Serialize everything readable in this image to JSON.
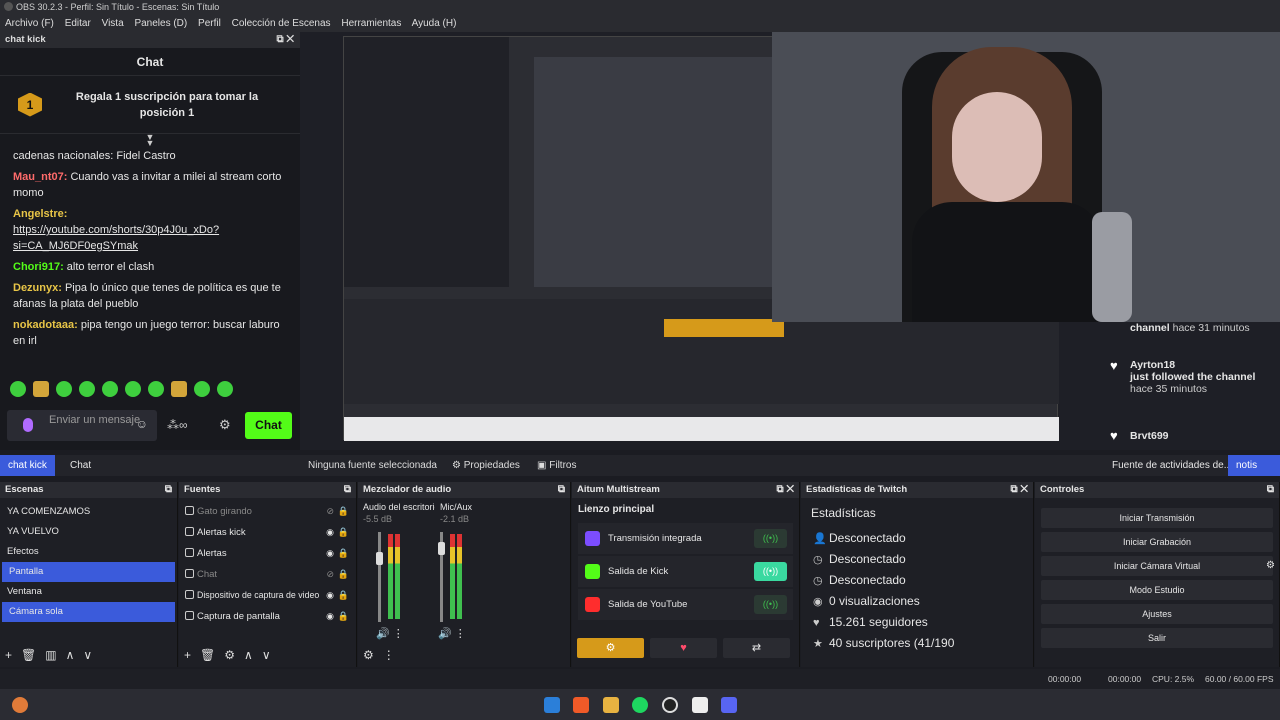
{
  "titlebar": {
    "title": "OBS 30.2.3 - Perfil: Sin Título - Escenas: Sin Título"
  },
  "menu": [
    "Archivo (F)",
    "Editar",
    "Vista",
    "Paneles (D)",
    "Perfil",
    "Colección de Escenas",
    "Herramientas",
    "Ayuda (H)"
  ],
  "chat_dock": {
    "title": "chat kick",
    "header": "Chat",
    "pinned_badge": "1",
    "pinned_text": "Regala 1 suscripción para tomar la posición 1",
    "messages": [
      {
        "user": "",
        "text": "cadenas nacionales: Fidel Castro",
        "color": "#e6e6e6"
      },
      {
        "user": "Mau_nt07:",
        "text": " Cuando vas a invitar a milei al stream corto momo",
        "color": "#ff6b6b"
      },
      {
        "user": "Angelstre:",
        "text": "https://youtube.com/shorts/30p4J0u_xDo?si=CA_MJ6DF0egSYmak",
        "color": "#e8c547"
      },
      {
        "user": "Chori917:",
        "text": " alto terror el clash",
        "color": "#53fc18"
      },
      {
        "user": "Dezunyx:",
        "text": " Pipa lo único que tenes de política es que te afanas la plata del pueblo",
        "color": "#e8c547"
      },
      {
        "user": "nokadotaaa:",
        "text": " pipa tengo un juego terror: buscar laburo en irl",
        "color": "#e8c547"
      }
    ],
    "input_placeholder": "Enviar un mensaje",
    "chat_button": "Chat",
    "emote_count": 10
  },
  "activity": {
    "items": [
      {
        "name": "channel",
        "meta": "hace 31 minutos"
      },
      {
        "name": "Ayrton18",
        "action": "just followed the channel",
        "meta": "hace 35 minutos"
      },
      {
        "name": "Brvt699",
        "meta": ""
      }
    ]
  },
  "tabbar": {
    "tabs": [
      "chat kick",
      "Chat"
    ],
    "no_source": "Ninguna fuente seleccionada",
    "properties": "Propiedades",
    "filters": "Filtros",
    "right_tabs": [
      "Fuente de actividades de...",
      "notis"
    ]
  },
  "scenes": {
    "title": "Escenas",
    "items": [
      "YA COMENZAMOS",
      "YA VUELVO",
      "Efectos",
      "Pantalla",
      "Ventana",
      "Cámara sola"
    ],
    "selected": [
      3,
      5
    ]
  },
  "sources": {
    "title": "Fuentes",
    "items": [
      {
        "label": "Gato girando",
        "visible": false
      },
      {
        "label": "Alertas kick",
        "visible": true
      },
      {
        "label": "Alertas",
        "visible": true
      },
      {
        "label": "Chat",
        "visible": false
      },
      {
        "label": "Dispositivo de captura de video",
        "visible": true
      },
      {
        "label": "Captura de pantalla",
        "visible": true
      }
    ]
  },
  "mixer": {
    "title": "Mezclador de audio",
    "channels": [
      {
        "name": "Audio del escritorio",
        "level": "-5.5 dB"
      },
      {
        "name": "Mic/Aux",
        "level": "-2.1 dB"
      }
    ],
    "scale": [
      "0",
      "-5",
      "-10",
      "-15",
      "-20",
      "-25",
      "-30",
      "-35",
      "-40",
      "-45",
      "-50",
      "-55",
      "-60"
    ]
  },
  "multistream": {
    "title": "Aitum Multistream",
    "canvas": "Lienzo principal",
    "outputs": [
      {
        "label": "Transmisión integrada",
        "active": false,
        "color": "#7c4dff"
      },
      {
        "label": "Salida de Kick",
        "active": true,
        "color": "#53fc18"
      },
      {
        "label": "Salida de YouTube",
        "active": false,
        "color": "#ff2d2d"
      }
    ]
  },
  "stats": {
    "title": "Estadísticas de Twitch",
    "header": "Estadísticas",
    "rows": [
      "Desconectado",
      "Desconectado",
      "Desconectado",
      "0 visualizaciones",
      "15.261 seguidores",
      "40 suscriptores (41/190"
    ]
  },
  "controls": {
    "title": "Controles",
    "buttons": [
      "Iniciar Transmisión",
      "Iniciar Grabación",
      "Iniciar Cámara Virtual",
      "Modo Estudio",
      "Ajustes",
      "Salir"
    ]
  },
  "status": {
    "time1": "00:00:00",
    "time2": "00:00:00",
    "cpu": "CPU: 2.5%",
    "fps": "60.00 / 60.00 FPS"
  }
}
